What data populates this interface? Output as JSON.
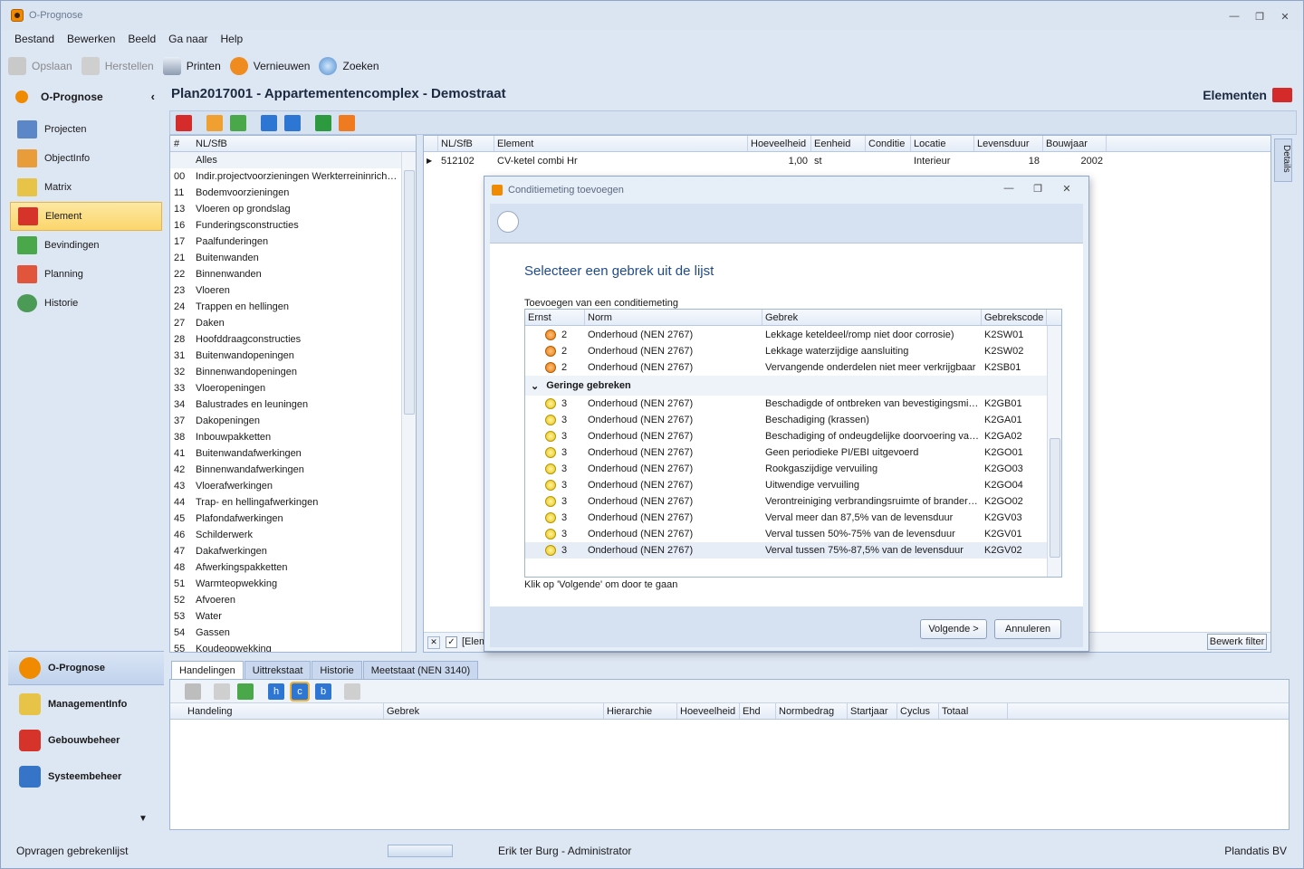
{
  "window": {
    "title": "O-Prognose"
  },
  "menu": [
    "Bestand",
    "Bewerken",
    "Beeld",
    "Ga naar",
    "Help"
  ],
  "toolbar": {
    "save": "Opslaan",
    "restore": "Herstellen",
    "print": "Printen",
    "refresh": "Vernieuwen",
    "search": "Zoeken"
  },
  "sidebar": {
    "title": "O-Prognose",
    "items": [
      "Projecten",
      "ObjectInfo",
      "Matrix",
      "Element",
      "Bevindingen",
      "Planning",
      "Historie"
    ]
  },
  "nav": [
    "O-Prognose",
    "ManagementInfo",
    "Gebouwbeheer",
    "Systeembeheer"
  ],
  "page": {
    "title": "Plan2017001 - Appartementencomplex - Demostraat",
    "section": "Elementen"
  },
  "nlsfb": {
    "headers": [
      "#",
      "NL/SfB"
    ],
    "rows": [
      [
        "",
        "Alles"
      ],
      [
        "00",
        "Indir.projectvoorzieningen Werkterreininrich…"
      ],
      [
        "11",
        "Bodemvoorzieningen"
      ],
      [
        "13",
        "Vloeren op grondslag"
      ],
      [
        "16",
        "Funderingsconstructies"
      ],
      [
        "17",
        "Paalfunderingen"
      ],
      [
        "21",
        "Buitenwanden"
      ],
      [
        "22",
        "Binnenwanden"
      ],
      [
        "23",
        "Vloeren"
      ],
      [
        "24",
        "Trappen en hellingen"
      ],
      [
        "27",
        "Daken"
      ],
      [
        "28",
        "Hoofddraagconstructies"
      ],
      [
        "31",
        "Buitenwandopeningen"
      ],
      [
        "32",
        "Binnenwandopeningen"
      ],
      [
        "33",
        "Vloeropeningen"
      ],
      [
        "34",
        "Balustrades en leuningen"
      ],
      [
        "37",
        "Dakopeningen"
      ],
      [
        "38",
        "Inbouwpakketten"
      ],
      [
        "41",
        "Buitenwandafwerkingen"
      ],
      [
        "42",
        "Binnenwandafwerkingen"
      ],
      [
        "43",
        "Vloerafwerkingen"
      ],
      [
        "44",
        "Trap- en hellingafwerkingen"
      ],
      [
        "45",
        "Plafondafwerkingen"
      ],
      [
        "46",
        "Schilderwerk"
      ],
      [
        "47",
        "Dakafwerkingen"
      ],
      [
        "48",
        "Afwerkingspakketten"
      ],
      [
        "51",
        "Warmteopwekking"
      ],
      [
        "52",
        "Afvoeren"
      ],
      [
        "53",
        "Water"
      ],
      [
        "54",
        "Gassen"
      ],
      [
        "55",
        "Koudeopwekking"
      ]
    ]
  },
  "elements": {
    "headers": [
      "NL/SfB",
      "Element",
      "Hoeveelheid",
      "Eenheid",
      "Conditie",
      "Locatie",
      "Levensduur",
      "Bouwjaar"
    ],
    "row": [
      "512102",
      "CV-ketel combi Hr",
      "1,00",
      "st",
      "",
      "Interieur",
      "18",
      "2002"
    ],
    "filter_text": "[Elem",
    "edit_filter": "Bewerk filter",
    "details": "Details"
  },
  "dialog": {
    "title": "Conditiemeting toevoegen",
    "heading": "Selecteer een gebrek uit de lijst",
    "subtitle": "Toevoegen van een conditiemeting",
    "headers": [
      "Ernst",
      "Norm",
      "Gebrek",
      "Gebrekscode"
    ],
    "rows_top": [
      [
        "2",
        "Onderhoud (NEN 2767)",
        "Lekkage keteldeel/romp niet door corrosie)",
        "K2SW01"
      ],
      [
        "2",
        "Onderhoud (NEN 2767)",
        "Lekkage waterzijdige aansluiting",
        "K2SW02"
      ],
      [
        "2",
        "Onderhoud (NEN 2767)",
        "Vervangende onderdelen niet meer verkrijgbaar",
        "K2SB01"
      ]
    ],
    "group": "Geringe gebreken",
    "rows_group": [
      [
        "3",
        "Onderhoud (NEN 2767)",
        "Beschadigde of ontbreken van bevestigingsmi…",
        "K2GB01"
      ],
      [
        "3",
        "Onderhoud (NEN 2767)",
        "Beschadiging (krassen)",
        "K2GA01"
      ],
      [
        "3",
        "Onderhoud (NEN 2767)",
        "Beschadiging of ondeugdelijke doorvoering va…",
        "K2GA02"
      ],
      [
        "3",
        "Onderhoud (NEN 2767)",
        "Geen periodieke PI/EBI uitgevoerd",
        "K2GO01"
      ],
      [
        "3",
        "Onderhoud (NEN 2767)",
        "Rookgaszijdige vervuiling",
        "K2GO03"
      ],
      [
        "3",
        "Onderhoud (NEN 2767)",
        "Uitwendige vervuiling",
        "K2GO04"
      ],
      [
        "3",
        "Onderhoud (NEN 2767)",
        "Verontreiniging verbrandingsruimte of brander…",
        "K2GO02"
      ],
      [
        "3",
        "Onderhoud (NEN 2767)",
        "Verval meer dan  87,5% van de levensduur",
        "K2GV03"
      ],
      [
        "3",
        "Onderhoud (NEN 2767)",
        "Verval tussen 50%-75% van de levensduur",
        "K2GV01"
      ],
      [
        "3",
        "Onderhoud (NEN 2767)",
        "Verval tussen 75%-87,5% van de levensduur",
        "K2GV02"
      ]
    ],
    "hint": "Klik op 'Volgende' om door te gaan",
    "next": "Volgende >",
    "cancel": "Annuleren"
  },
  "tabs": [
    "Handelingen",
    "Uittrekstaat",
    "Historie",
    "Meetstaat (NEN 3140)"
  ],
  "actions": {
    "headers": [
      "Handeling",
      "Gebrek",
      "Hierarchie",
      "Hoeveelheid",
      "Ehd",
      "Normbedrag",
      "Startjaar",
      "Cyclus",
      "Totaal"
    ],
    "btn_h": "h",
    "btn_c": "c",
    "btn_b": "b"
  },
  "status": {
    "left": "Opvragen gebrekenlijst",
    "user": "Erik ter Burg - Administrator",
    "company": "Plandatis BV"
  }
}
